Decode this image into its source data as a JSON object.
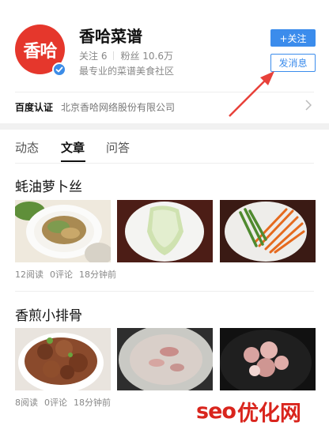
{
  "profile": {
    "avatar_text": "香哈",
    "name": "香哈菜谱",
    "following": "关注 6",
    "followers": "粉丝 10.6万",
    "slogan": "最专业的菜谱美食社区",
    "follow_label": "+关注",
    "message_label": "发消息",
    "auth_label": "百度认证",
    "auth_value": "北京香哈网络股份有限公司"
  },
  "tabs": [
    {
      "label": "动态",
      "active": false
    },
    {
      "label": "文章",
      "active": true
    },
    {
      "label": "问答",
      "active": false
    }
  ],
  "articles": [
    {
      "title": "蚝油萝卜丝",
      "reads": "12阅读",
      "comments": "0评论",
      "time": "18分钟前"
    },
    {
      "title": "香煎小排骨",
      "reads": "8阅读",
      "comments": "0评论",
      "time": "18分钟前"
    }
  ],
  "watermark": {
    "latin": "seo",
    "cjk": "优化网"
  },
  "colors": {
    "brand_red": "#e5372c",
    "accent_blue": "#3b8cec",
    "annotation_red": "#e8413a"
  }
}
